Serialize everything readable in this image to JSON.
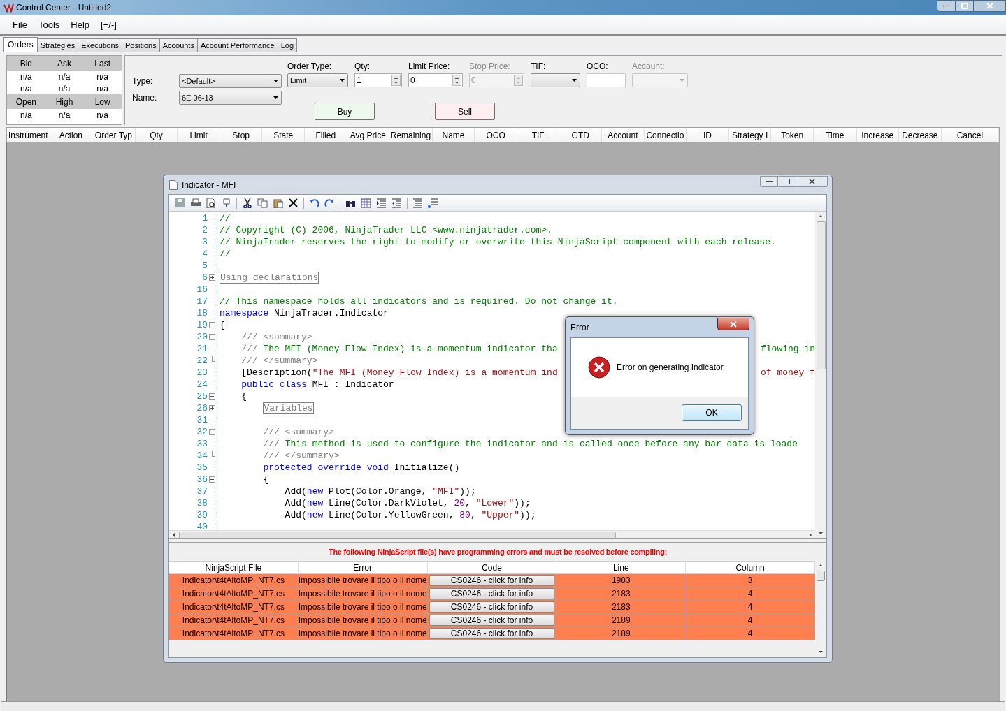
{
  "window": {
    "title": "Control Center - Untitled2"
  },
  "menu": [
    "File",
    "Tools",
    "Help",
    "[+/-]"
  ],
  "tabs": [
    {
      "label": "Orders",
      "selected": true
    },
    {
      "label": "Strategies",
      "selected": false
    },
    {
      "label": "Executions",
      "selected": false
    },
    {
      "label": "Positions",
      "selected": false
    },
    {
      "label": "Accounts",
      "selected": false
    },
    {
      "label": "Account Performance",
      "selected": false
    },
    {
      "label": "Log",
      "selected": false
    }
  ],
  "quote": {
    "rows": [
      {
        "kind": "header",
        "cells": [
          "Bid",
          "Ask",
          "Last"
        ]
      },
      {
        "kind": "value",
        "cells": [
          "n/a",
          "n/a",
          "n/a"
        ]
      },
      {
        "kind": "value",
        "cells": [
          "n/a",
          "n/a",
          "n/a"
        ]
      },
      {
        "kind": "header",
        "cells": [
          "Open",
          "High",
          "Low"
        ]
      },
      {
        "kind": "value",
        "cells": [
          "n/a",
          "n/a",
          "n/a"
        ]
      }
    ]
  },
  "order_form": {
    "type_label": "Type:",
    "type_value": "<Default>",
    "name_label": "Name:",
    "name_value": "6E 06-13",
    "fields": [
      {
        "label": "Order Type:",
        "kind": "dropdown",
        "value": "Limit",
        "disabled": false
      },
      {
        "label": "Qty:",
        "kind": "spinner",
        "value": "1",
        "disabled": false
      },
      {
        "label": "Limit Price:",
        "kind": "spinner",
        "value": "0",
        "disabled": false
      },
      {
        "label": "Stop Price:",
        "kind": "spinner",
        "value": "0",
        "disabled": true
      },
      {
        "label": "TIF:",
        "kind": "dropdown",
        "disabled": false
      },
      {
        "label": "OCO:",
        "kind": "text",
        "disabled": false
      },
      {
        "label": "Account:",
        "kind": "dropdown",
        "disabled": true
      }
    ],
    "buttons": [
      {
        "label": "Buy",
        "kind": "buy"
      },
      {
        "label": "Sell",
        "kind": "sell"
      }
    ]
  },
  "orders_table": {
    "columns": [
      "Instrument",
      "Action",
      "Order Typ",
      "Qty",
      "Limit",
      "Stop",
      "State",
      "Filled",
      "Avg Price",
      "Remaining",
      "Name",
      "OCO",
      "TIF",
      "GTD",
      "Account",
      "Connectio",
      "ID",
      "Strategy I",
      "Token",
      "Time",
      "Increase",
      "Decrease",
      "Cancel"
    ]
  },
  "editor_window": {
    "title": "Indicator - MFI",
    "lines": [
      {
        "number": "1",
        "kind": "plain",
        "segments": [
          {
            "kind": "comment",
            "text": "//"
          }
        ]
      },
      {
        "number": "2",
        "kind": "plain",
        "segments": [
          {
            "kind": "comment",
            "text": "// Copyright (C) 2006, NinjaTrader LLC <www.ninjatrader.com>."
          }
        ]
      },
      {
        "number": "3",
        "kind": "plain",
        "segments": [
          {
            "kind": "comment",
            "text": "// NinjaTrader reserves the right to modify or overwrite this NinjaScript component with each release."
          }
        ]
      },
      {
        "number": "4",
        "kind": "plain",
        "segments": [
          {
            "kind": "comment",
            "text": "//"
          }
        ]
      },
      {
        "number": "5",
        "kind": "plain"
      },
      {
        "number": "6",
        "kind": "fold_closed",
        "segments": [
          {
            "kind": "region",
            "text": "Using declarations"
          }
        ]
      },
      {
        "number": "16",
        "kind": "plain"
      },
      {
        "number": "17",
        "kind": "plain",
        "segments": [
          {
            "kind": "comment",
            "text": "// This namespace holds all indicators and is required. Do not change it."
          }
        ]
      },
      {
        "number": "18",
        "kind": "plain",
        "segments": [
          {
            "kind": "keyword",
            "text": "namespace"
          },
          {
            "kind": "plain",
            "text": " NinjaTrader.Indicator"
          }
        ]
      },
      {
        "number": "19",
        "kind": "fold_open",
        "segments": [
          {
            "kind": "plain",
            "text": "{"
          }
        ]
      },
      {
        "number": "20",
        "kind": "fold_open",
        "segments": [
          {
            "kind": "doc",
            "text": "    /// <summary>"
          }
        ]
      },
      {
        "number": "21",
        "kind": "plain",
        "segments": [
          {
            "kind": "doc",
            "text": "    ///"
          },
          {
            "kind": "comment",
            "text": " The MFI (Money Flow Index) is a momentum indicator tha"
          }
        ],
        "tail": {
          "kind": "comment",
          "text": "flowing in"
        }
      },
      {
        "number": "22",
        "kind": "fold_end",
        "segments": [
          {
            "kind": "doc",
            "text": "    /// </summary>"
          }
        ]
      },
      {
        "number": "23",
        "kind": "plain",
        "segments": [
          {
            "kind": "plain",
            "text": "    [Description("
          },
          {
            "kind": "string",
            "text": "\"The MFI (Money Flow Index) is a momentum ind"
          }
        ],
        "tail": {
          "kind": "string",
          "text": "of money f"
        }
      },
      {
        "number": "24",
        "kind": "plain",
        "segments": [
          {
            "kind": "keyword",
            "text": "    public class"
          },
          {
            "kind": "plain",
            "text": " MFI : Indicator"
          }
        ]
      },
      {
        "number": "25",
        "kind": "fold_open",
        "segments": [
          {
            "kind": "plain",
            "text": "    {"
          }
        ]
      },
      {
        "number": "26",
        "kind": "fold_closed",
        "segments": [
          {
            "kind": "region",
            "text": "Variables"
          }
        ],
        "indented": true
      },
      {
        "number": "31",
        "kind": "plain"
      },
      {
        "number": "32",
        "kind": "fold_open",
        "segments": [
          {
            "kind": "doc",
            "text": "        /// <summary>"
          }
        ]
      },
      {
        "number": "33",
        "kind": "plain",
        "segments": [
          {
            "kind": "doc",
            "text": "        ///"
          },
          {
            "kind": "comment",
            "text": " This method is used to configure the indicator and is called once before any bar data is loade"
          }
        ]
      },
      {
        "number": "34",
        "kind": "fold_end",
        "segments": [
          {
            "kind": "doc",
            "text": "        /// </summary>"
          }
        ]
      },
      {
        "number": "35",
        "kind": "plain",
        "segments": [
          {
            "kind": "keyword",
            "text": "        protected override void"
          },
          {
            "kind": "plain",
            "text": " Initialize()"
          }
        ]
      },
      {
        "number": "36",
        "kind": "fold_open",
        "segments": [
          {
            "kind": "plain",
            "text": "        {"
          }
        ]
      },
      {
        "number": "37",
        "kind": "plain",
        "segments": [
          {
            "kind": "plain",
            "text": "            Add("
          },
          {
            "kind": "keyword",
            "text": "new"
          },
          {
            "kind": "plain",
            "text": " Plot(Color.Orange, "
          },
          {
            "kind": "string",
            "text": "\"MFI\""
          },
          {
            "kind": "plain",
            "text": "));"
          }
        ]
      },
      {
        "number": "38",
        "kind": "plain",
        "segments": [
          {
            "kind": "plain",
            "text": "            Add("
          },
          {
            "kind": "keyword",
            "text": "new"
          },
          {
            "kind": "plain",
            "text": " Line(Color.DarkViolet, "
          },
          {
            "kind": "number",
            "text": "20"
          },
          {
            "kind": "plain",
            "text": ", "
          },
          {
            "kind": "string",
            "text": "\"Lower\""
          },
          {
            "kind": "plain",
            "text": "));"
          }
        ]
      },
      {
        "number": "39",
        "kind": "plain",
        "segments": [
          {
            "kind": "plain",
            "text": "            Add("
          },
          {
            "kind": "keyword",
            "text": "new"
          },
          {
            "kind": "plain",
            "text": " Line(Color.YellowGreen, "
          },
          {
            "kind": "number",
            "text": "80"
          },
          {
            "kind": "plain",
            "text": ", "
          },
          {
            "kind": "string",
            "text": "\"Upper\""
          },
          {
            "kind": "plain",
            "text": "));"
          }
        ]
      },
      {
        "number": "40",
        "kind": "plain"
      }
    ],
    "error_panel": {
      "message": "The following NinjaScript file(s) have programming errors and must be resolved before compiling:",
      "columns": [
        "NinjaScript File",
        "Error",
        "Code",
        "Line",
        "Column"
      ],
      "rows": [
        {
          "file": "Indicator\\t4tAltoMP_NT7.cs",
          "error": "Impossibile trovare il tipo o il nome",
          "code": "CS0246 - click for info",
          "line": "1983",
          "column": "3"
        },
        {
          "file": "Indicator\\t4tAltoMP_NT7.cs",
          "error": "Impossibile trovare il tipo o il nome",
          "code": "CS0246 - click for info",
          "line": "2183",
          "column": "4"
        },
        {
          "file": "Indicator\\t4tAltoMP_NT7.cs",
          "error": "Impossibile trovare il tipo o il nome",
          "code": "CS0246 - click for info",
          "line": "2183",
          "column": "4"
        },
        {
          "file": "Indicator\\t4tAltoMP_NT7.cs",
          "error": "Impossibile trovare il tipo o il nome",
          "code": "CS0246 - click for info",
          "line": "2189",
          "column": "4"
        },
        {
          "file": "Indicator\\t4tAltoMP_NT7.cs",
          "error": "Impossibile trovare il tipo o il nome",
          "code": "CS0246 - click for info",
          "line": "2189",
          "column": "4"
        }
      ]
    }
  },
  "error_dialog": {
    "title": "Error",
    "message": "Error on generating Indicator",
    "button": "OK"
  }
}
